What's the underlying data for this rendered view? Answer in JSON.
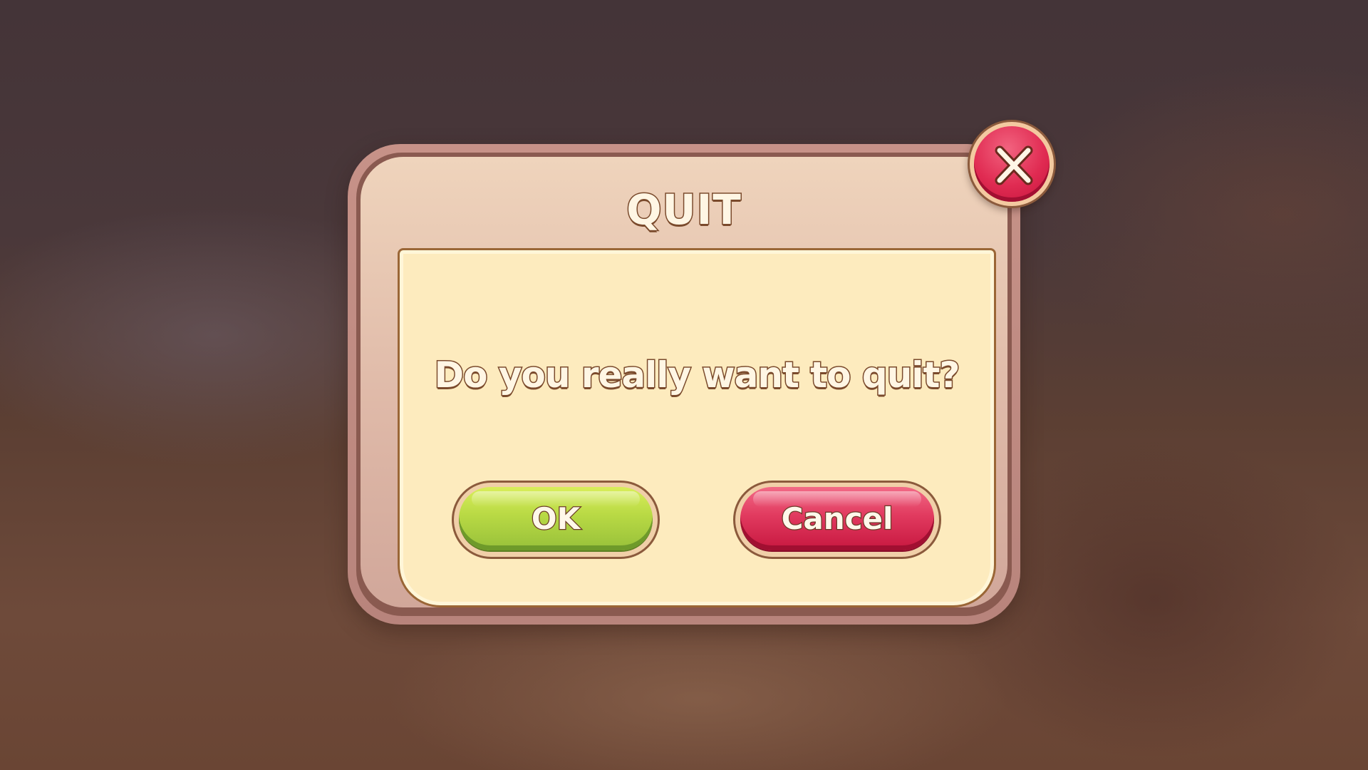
{
  "dialog": {
    "title": "QUIT",
    "message": "Do you really want to quit?",
    "ok_label": "OK",
    "cancel_label": "Cancel"
  },
  "icons": {
    "close": "close-icon"
  },
  "colors": {
    "ok_button": "#b8d944",
    "cancel_button": "#e13a5f",
    "close_button": "#e02b52",
    "panel": "#fdebbe",
    "frame": "#dfb9a8",
    "text_outline": "#7a4a2c"
  }
}
